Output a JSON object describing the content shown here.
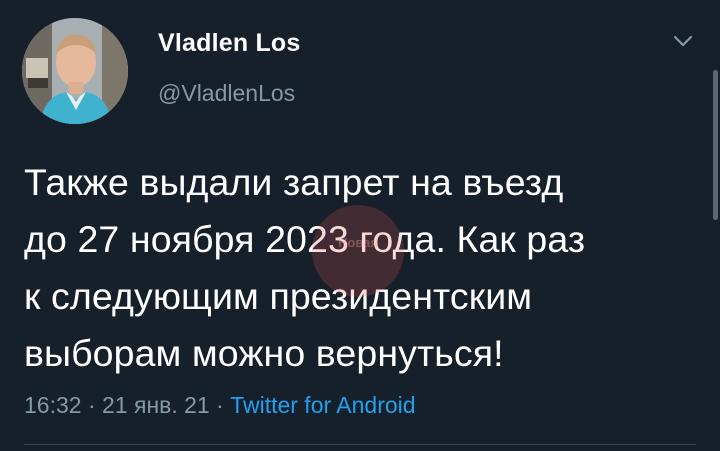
{
  "author": {
    "name": "Vladlen Los",
    "handle": "@VladlenLos"
  },
  "tweet": {
    "lines": [
      "Также выдали запрет на въезд",
      "до 27 ноября 2023 года. Как раз",
      "к следующим президентским",
      "выборам можно вернуться!"
    ]
  },
  "meta": {
    "time": "16:32",
    "separator": "·",
    "date": "21 янв. 21",
    "source": "Twitter for Android"
  },
  "watermark": {
    "text": "Новая"
  },
  "icons": {
    "menu": "chevron-down-icon"
  },
  "colors": {
    "background": "#15202b",
    "text": "#ffffff",
    "secondary": "#8899a6",
    "link": "#1da1f2"
  }
}
